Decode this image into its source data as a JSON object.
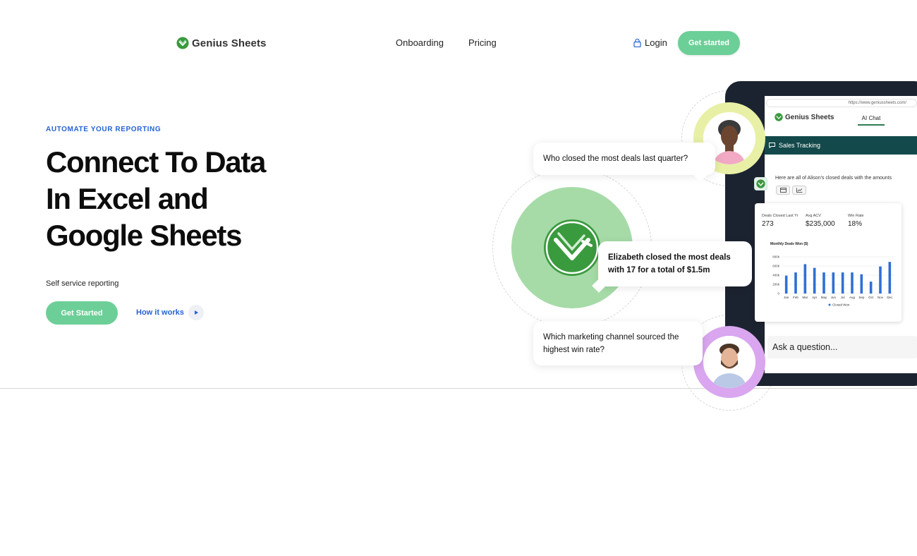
{
  "header": {
    "brand": "Genius Sheets",
    "nav": [
      "Onboarding",
      "Pricing"
    ],
    "login_label": "Login",
    "cta_label": "Get started"
  },
  "hero": {
    "eyebrow": "AUTOMATE YOUR REPORTING",
    "headline_lines": [
      "Connect To Data",
      "In Excel and",
      "Google Sheets"
    ],
    "subtext": "Self service reporting",
    "primary_cta": "Get Started",
    "secondary_cta": "How it works"
  },
  "colors": {
    "accent_green": "#6ccf97",
    "link_blue": "#2563d4",
    "brand_green": "#3a9a3e",
    "bar_blue": "#2f6fd6",
    "tablet_dark": "#1c2330",
    "sales_bar": "#13494a"
  },
  "illustration": {
    "url": "https://www.geniussheets.com/",
    "app_brand": "Genius Sheets",
    "tab": "AI Chat",
    "sheet_title": "Sales Tracking",
    "bot_reply": "Here are all of Alison's closed deals with the amounts",
    "question_1": "Who closed the most deals last quarter?",
    "answer": "Elizabeth closed the most deals with 17 for a total of $1.5m",
    "question_2": "Which marketing channel sourced the highest win rate?",
    "ask_placeholder": "Ask a question...",
    "stats": [
      {
        "label": "Deals Closed Last Yr",
        "value": "273"
      },
      {
        "label": "Avg ACV",
        "value": "$235,000"
      },
      {
        "label": "Win Rate",
        "value": "18%"
      }
    ],
    "chart_title": "Monthly Deals Won ($)",
    "legend": "Closed Won",
    "icons": [
      "chat-bubble-icon",
      "table-view-icon",
      "chart-view-icon",
      "lock-icon",
      "play-icon"
    ]
  },
  "chart_data": {
    "type": "bar",
    "title": "Monthly Deals Won ($)",
    "categories": [
      "Jan",
      "Feb",
      "Mar",
      "Apr",
      "May",
      "Jun",
      "Jul",
      "Aug",
      "Sep",
      "Oct",
      "Nov",
      "Dec"
    ],
    "series": [
      {
        "name": "Closed Won",
        "values": [
          390000,
          460000,
          640000,
          560000,
          460000,
          460000,
          460000,
          460000,
          420000,
          260000,
          590000,
          690000
        ]
      }
    ],
    "yticks": [
      "0",
      "200k",
      "400k",
      "600k",
      "800k"
    ],
    "ylim": [
      0,
      800000
    ],
    "legend": "bottom"
  }
}
